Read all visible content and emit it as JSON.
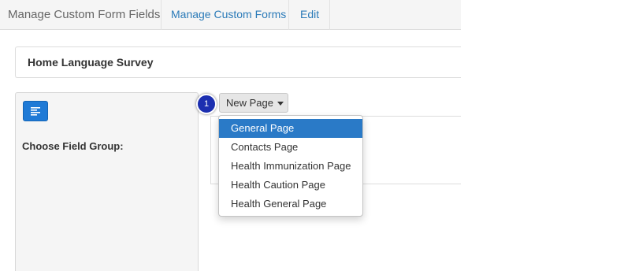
{
  "nav": {
    "title": "Manage Custom Form Fields",
    "links": [
      "Manage Custom Forms",
      "Edit"
    ]
  },
  "form": {
    "title": "Home Language Survey"
  },
  "sidebar": {
    "menu_icon": "align-left-icon",
    "label": "Choose Field Group:"
  },
  "toolbar": {
    "new_page_label": "New Page",
    "step_badge": "1"
  },
  "dropdown": {
    "items": [
      "General Page",
      "Contacts Page",
      "Health Immunization Page",
      "Health Caution Page",
      "Health General Page"
    ],
    "active_index": 0
  },
  "colors": {
    "link": "#2a7ab8",
    "primary": "#1f7ad6",
    "highlight": "#2a7ac7",
    "badge": "#1c2fb0"
  }
}
